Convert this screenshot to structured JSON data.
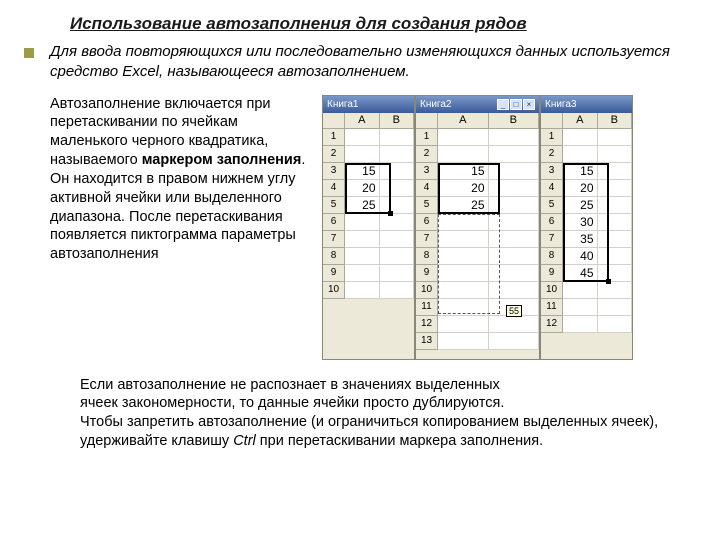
{
  "title": "Использование автозаполнения для создания рядов",
  "subtitle": "Для ввода повторяющихся или последовательно изменяющихся данных используется средство Excel, называющееся автозаполнением.",
  "desc": {
    "p1": "Автозаполнение включается при перетаскивании по ячейкам маленького черного квадратика, называемого ",
    "bold": "маркером заполнения",
    "p2": ". Он находится в правом нижнем углу активной ячейки или выделенного диапазона. После перетаскивания появляется пиктограмма параметры автозаполнения"
  },
  "books": {
    "b1": {
      "title": "Книга1",
      "cols": [
        "A",
        "B"
      ],
      "rows": 10,
      "values": {
        "3": "15",
        "4": "20",
        "5": "25"
      }
    },
    "b2": {
      "title": "Книга2",
      "cols": [
        "A",
        "B"
      ],
      "rows": 13,
      "values": {
        "3": "15",
        "4": "20",
        "5": "25"
      },
      "tip": "55"
    },
    "b3": {
      "title": "Книга3",
      "cols": [
        "A",
        "B"
      ],
      "rows": 12,
      "values": {
        "3": "15",
        "4": "20",
        "5": "25",
        "6": "30",
        "7": "35",
        "8": "40",
        "9": "45"
      }
    }
  },
  "footer": {
    "l1": "Если автозаполнение не распознает в значениях выделенных",
    "l2": "ячеек закономерности, то данные ячейки просто дублируются.",
    "l3": "Чтобы запретить автозаполнение (и ограничиться копированием выделенных ячеек), удерживайте клавишу",
    "l4": "Ctrl",
    "l5": " при перетаскивании маркера заполнения."
  }
}
